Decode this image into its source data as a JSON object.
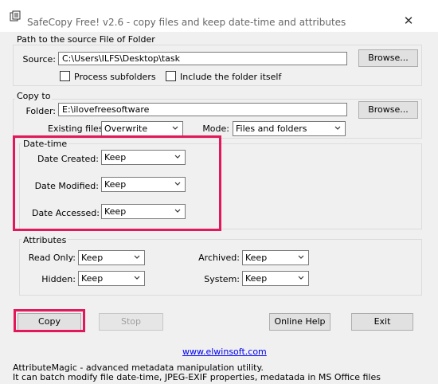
{
  "window": {
    "title": "SafeCopy Free! v2.6 - copy files and keep date-time and attributes",
    "close_glyph": "✕"
  },
  "source_group": {
    "title": "Path to the source File of Folder",
    "source_label": "Source:",
    "source_value": "C:\\Users\\ILFS\\Desktop\\task",
    "browse_label": "Browse...",
    "process_subfolders_label": "Process subfolders",
    "include_folder_label": "Include the folder itself"
  },
  "copy_group": {
    "title": "Copy to",
    "folder_label": "Folder:",
    "folder_value": "E:\\ilovefreesoftware",
    "browse_label": "Browse...",
    "existing_files_label": "Existing files:",
    "existing_files_value": "Overwrite",
    "mode_label": "Mode:",
    "mode_value": "Files and folders"
  },
  "datetime_group": {
    "title": "Date-time",
    "created_label": "Date Created:",
    "created_value": "Keep",
    "modified_label": "Date Modified:",
    "modified_value": "Keep",
    "accessed_label": "Date Accessed:",
    "accessed_value": "Keep"
  },
  "attributes_group": {
    "title": "Attributes",
    "read_only_label": "Read Only:",
    "read_only_value": "Keep",
    "hidden_label": "Hidden:",
    "hidden_value": "Keep",
    "archived_label": "Archived:",
    "archived_value": "Keep",
    "system_label": "System:",
    "system_value": "Keep"
  },
  "actions": {
    "copy_label": "Copy",
    "stop_label": "Stop",
    "online_help_label": "Online Help",
    "exit_label": "Exit"
  },
  "footer": {
    "link": "www.elwinsoft.com",
    "line1": "AttributeMagic - advanced metadata manipulation utility.",
    "line2": "It can batch modify file date-time, JPEG-EXIF properties, medatada in MS Office files"
  },
  "colors": {
    "highlight": "#e2185a",
    "link": "#0000ee"
  }
}
